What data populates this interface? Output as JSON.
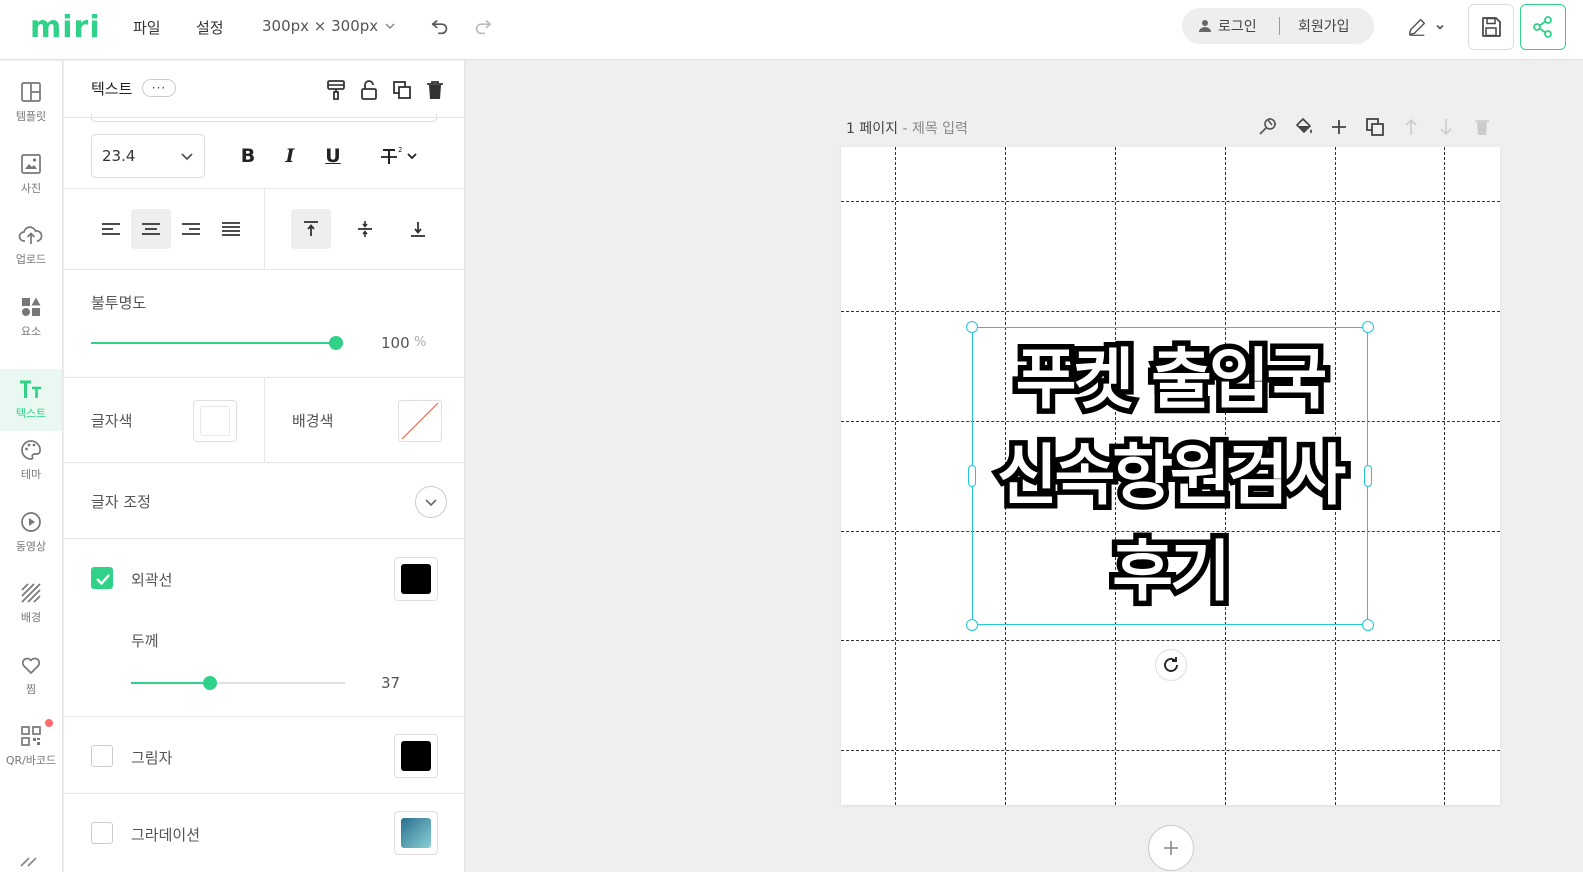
{
  "app": {
    "logo": "miri",
    "menu": [
      "파일",
      "설정"
    ],
    "canvas_size": "300px × 300px",
    "auth": {
      "login": "로그인",
      "signup": "회원가입"
    }
  },
  "leftnav": {
    "items": [
      {
        "label": "템플릿",
        "icon": "layout-icon"
      },
      {
        "label": "사진",
        "icon": "image-icon"
      },
      {
        "label": "업로드",
        "icon": "upload-cloud-icon"
      },
      {
        "label": "요소",
        "icon": "shapes-icon"
      },
      {
        "label": "텍스트",
        "icon": "text-icon",
        "active": true
      },
      {
        "label": "테마",
        "icon": "palette-icon"
      },
      {
        "label": "동영상",
        "icon": "play-icon"
      },
      {
        "label": "배경",
        "icon": "pattern-icon"
      },
      {
        "label": "찜",
        "icon": "heart-icon"
      },
      {
        "label": "QR/바코드",
        "icon": "qr-icon",
        "badge": true
      }
    ]
  },
  "panel": {
    "title": "텍스트",
    "more": "···",
    "font_size": "23.4",
    "bold": "B",
    "italic": "I",
    "underline": "U",
    "opacity": {
      "label": "불투명도",
      "value": "100",
      "unit": "%",
      "level": 1.0
    },
    "text_color": {
      "label": "글자색",
      "color": "#ffffff"
    },
    "bg_color": {
      "label": "배경색",
      "color": "none"
    },
    "text_adjust": {
      "label": "글자 조정"
    },
    "outline": {
      "label": "외곽선",
      "checked": true,
      "color": "#000000",
      "thickness_label": "두께",
      "thickness": "37",
      "level": 0.37
    },
    "shadow": {
      "label": "그림자",
      "checked": false,
      "color": "#000000"
    },
    "gradient": {
      "label": "그라데이션",
      "checked": false
    }
  },
  "canvas": {
    "page_number": "1 페이지",
    "separator": " - ",
    "title_placeholder": "제목 입력",
    "text_lines": [
      "푸켓 출입국",
      "신속항원검사",
      "후기"
    ]
  }
}
